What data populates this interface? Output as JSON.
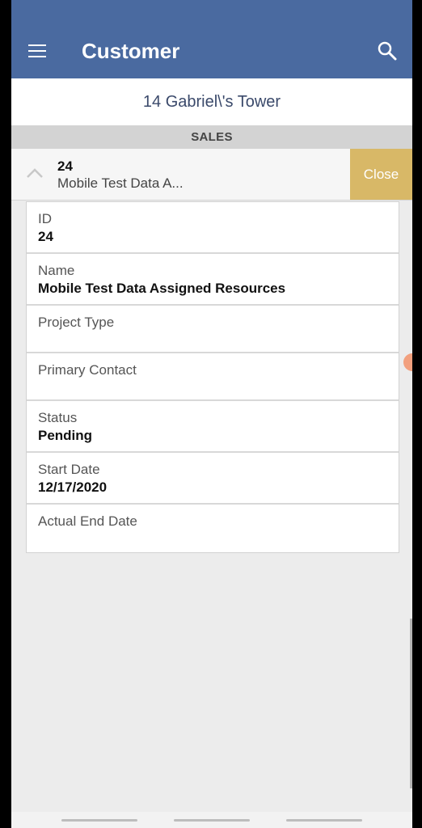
{
  "appbar": {
    "title": "Customer",
    "menu_icon": "hamburger-menu-icon",
    "search_icon": "search-icon",
    "color": "#4a6aa0"
  },
  "subheader": {
    "title": "14 Gabriel\\'s Tower"
  },
  "section": {
    "label": "SALES"
  },
  "record": {
    "id": "24",
    "name_truncated": "Mobile Test Data A...",
    "close_label": "Close",
    "close_color": "#d8b867"
  },
  "fields": {
    "id": {
      "label": "ID",
      "value": "24"
    },
    "name": {
      "label": "Name",
      "value": "Mobile Test Data Assigned Resources"
    },
    "project_type": {
      "label": "Project Type",
      "value": ""
    },
    "primary_contact": {
      "label": "Primary Contact",
      "value": ""
    },
    "status": {
      "label": "Status",
      "value": "Pending"
    },
    "start_date": {
      "label": "Start Date",
      "value": "12/17/2020"
    },
    "actual_end_date": {
      "label": "Actual End Date",
      "value": ""
    }
  }
}
